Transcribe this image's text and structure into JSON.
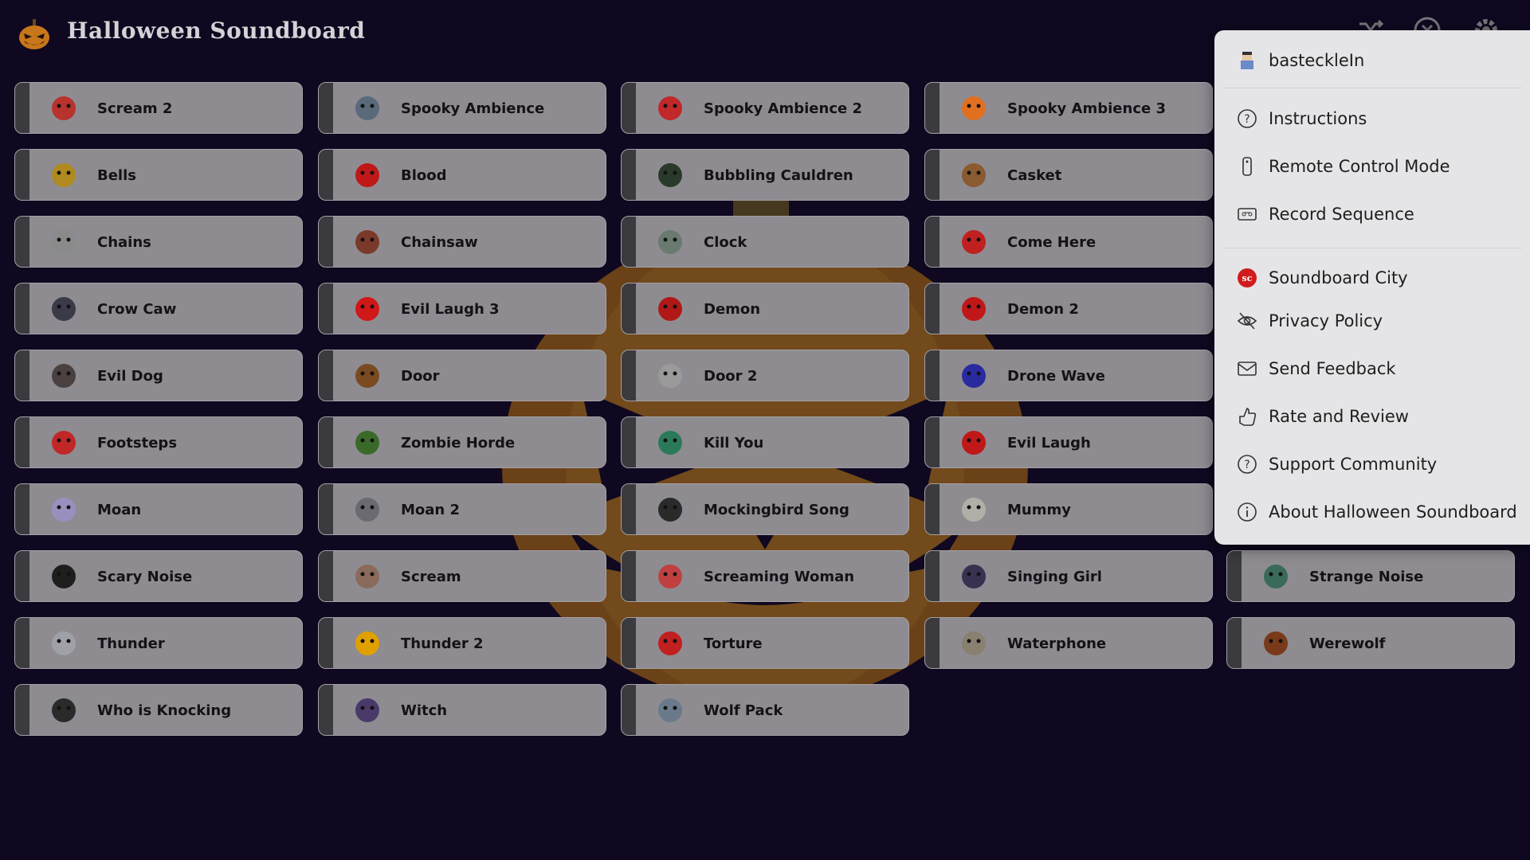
{
  "app": {
    "title": "Halloween Soundboard"
  },
  "toolbar": {
    "icons": [
      "shuffle-icon",
      "stop-icon",
      "gear-icon"
    ]
  },
  "sounds": [
    {
      "label": "Scream 2",
      "color": "#b8322e"
    },
    {
      "label": "Spooky Ambience",
      "color": "#5a6a7a"
    },
    {
      "label": "Spooky Ambience 2",
      "color": "#c0282a"
    },
    {
      "label": "Spooky Ambience 3",
      "color": "#e07020"
    },
    {
      "label": "Bells",
      "color": "#b08a20"
    },
    {
      "label": "Blood",
      "color": "#c01818"
    },
    {
      "label": "Bubbling Cauldren",
      "color": "#2a3a2a"
    },
    {
      "label": "Casket",
      "color": "#8a5a30"
    },
    {
      "label": "Chains",
      "color": "#8a8a8a"
    },
    {
      "label": "Chainsaw",
      "color": "#7a3a2a"
    },
    {
      "label": "Clock",
      "color": "#6a7a70"
    },
    {
      "label": "Come Here",
      "color": "#c02020"
    },
    {
      "label": "Crow Caw",
      "color": "#3a3a48"
    },
    {
      "label": "Evil Laugh 3",
      "color": "#d01818"
    },
    {
      "label": "Demon",
      "color": "#b01818"
    },
    {
      "label": "Demon 2",
      "color": "#c01818"
    },
    {
      "label": "Evil Dog",
      "color": "#4a4040"
    },
    {
      "label": "Door",
      "color": "#7a4a20"
    },
    {
      "label": "Door 2",
      "color": "#9a9a9a"
    },
    {
      "label": "Drone Wave",
      "color": "#2a2aa0"
    },
    {
      "label": "Footsteps",
      "color": "#c02828"
    },
    {
      "label": "Zombie Horde",
      "color": "#3a6a2a"
    },
    {
      "label": "Kill You",
      "color": "#2a7a5a"
    },
    {
      "label": "Evil Laugh",
      "color": "#c01818"
    },
    {
      "label": "Moan",
      "color": "#9a90c0"
    },
    {
      "label": "Moan 2",
      "color": "#6a6a70"
    },
    {
      "label": "Mockingbird Song",
      "color": "#2a2a2a"
    },
    {
      "label": "Mummy",
      "color": "#b0b0a8"
    },
    {
      "label": "Scary Noise",
      "color": "#1e1e1e"
    },
    {
      "label": "Scream",
      "color": "#8a6a5a"
    },
    {
      "label": "Screaming Woman",
      "color": "#c04040"
    },
    {
      "label": "Singing Girl",
      "color": "#3a3050"
    },
    {
      "label": "Thunder",
      "color": "#a0a0a8"
    },
    {
      "label": "Thunder 2",
      "color": "#e0a000"
    },
    {
      "label": "Torture",
      "color": "#c02020"
    },
    {
      "label": "Waterphone",
      "color": "#8a8070"
    },
    {
      "label": "Who is Knocking",
      "color": "#2a2a2a"
    },
    {
      "label": "Witch",
      "color": "#4a3a6a"
    },
    {
      "label": "Wolf Pack",
      "color": "#6a7a8a"
    },
    {
      "label": "Strange Noise",
      "color": "#3a6a5a"
    },
    {
      "label": "Werewolf",
      "color": "#7a3a1a"
    }
  ],
  "menu": {
    "user": "basteckleIn",
    "items": [
      {
        "label": "Instructions",
        "icon": "help-circle-icon"
      },
      {
        "label": "Remote Control Mode",
        "icon": "remote-icon"
      },
      {
        "label": "Record Sequence",
        "icon": "cassette-icon"
      },
      {
        "label": "Soundboard City",
        "icon": "soundboard-city-logo-icon"
      },
      {
        "label": "Privacy Policy",
        "icon": "eye-off-icon"
      },
      {
        "label": "Send Feedback",
        "icon": "mail-icon"
      },
      {
        "label": "Rate and Review",
        "icon": "thumbs-up-icon"
      },
      {
        "label": "Support Community",
        "icon": "help-circle-icon"
      },
      {
        "label": "About Halloween Soundboard",
        "icon": "info-icon"
      }
    ]
  },
  "colors": {
    "background": "#0f0820",
    "button": "#8e8c91",
    "menu": "#e5e5e7",
    "accent": "#e07a10"
  }
}
